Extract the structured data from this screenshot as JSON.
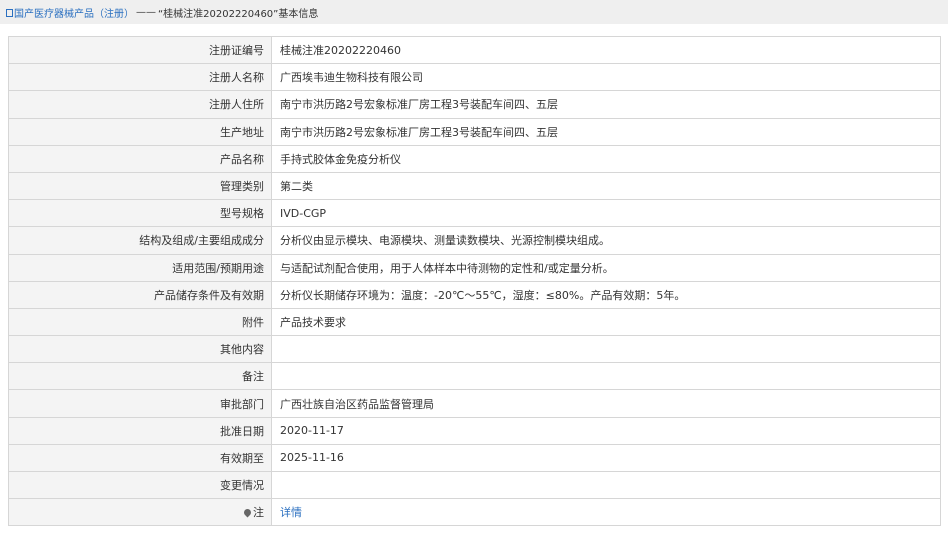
{
  "breadcrumb": {
    "home": "国产医疗器械产品（注册）",
    "separator": "——",
    "current": "“桂械注准20202220460”基本信息"
  },
  "rows": [
    {
      "label": "注册证编号",
      "value": "桂械注准20202220460"
    },
    {
      "label": "注册人名称",
      "value": "广西埃韦迪生物科技有限公司"
    },
    {
      "label": "注册人住所",
      "value": "南宁市洪历路2号宏象标准厂房工程3号装配车间四、五层"
    },
    {
      "label": "生产地址",
      "value": "南宁市洪历路2号宏象标准厂房工程3号装配车间四、五层"
    },
    {
      "label": "产品名称",
      "value": "手持式胶体金免疫分析仪"
    },
    {
      "label": "管理类别",
      "value": "第二类"
    },
    {
      "label": "型号规格",
      "value": "IVD-CGP"
    },
    {
      "label": "结构及组成/主要组成成分",
      "value": "分析仪由显示模块、电源模块、测量读数模块、光源控制模块组成。"
    },
    {
      "label": "适用范围/预期用途",
      "value": "与适配试剂配合使用，用于人体样本中待测物的定性和/或定量分析。"
    },
    {
      "label": "产品储存条件及有效期",
      "value": "分析仪长期储存环境为：温度：-20℃～55℃，湿度：≤80%。产品有效期：5年。"
    },
    {
      "label": "附件",
      "value": "产品技术要求"
    },
    {
      "label": "其他内容",
      "value": ""
    },
    {
      "label": "备注",
      "value": ""
    },
    {
      "label": "审批部门",
      "value": "广西壮族自治区药品监督管理局"
    },
    {
      "label": "批准日期",
      "value": "2020-11-17"
    },
    {
      "label": "有效期至",
      "value": "2025-11-16"
    },
    {
      "label": "变更情况",
      "value": ""
    }
  ],
  "note": {
    "label": "注",
    "link": "详情"
  }
}
